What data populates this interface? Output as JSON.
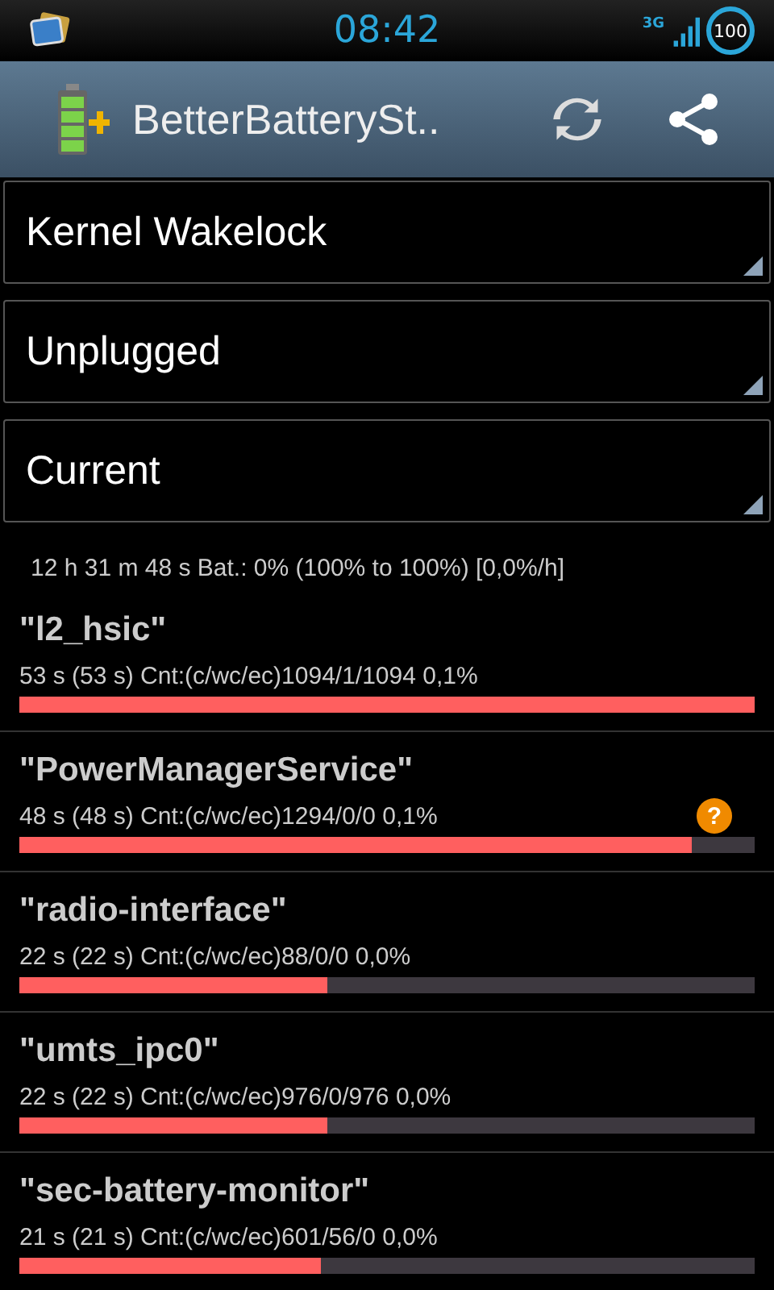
{
  "status_bar": {
    "time": "08:42",
    "network": "3G",
    "battery": "100"
  },
  "action_bar": {
    "title": "BetterBatterySt.."
  },
  "spinners": [
    {
      "value": "Kernel Wakelock"
    },
    {
      "value": "Unplugged"
    },
    {
      "value": "Current"
    }
  ],
  "summary": "12 h 31 m 48 s  Bat.: 0% (100% to 100%) [0,0%/h]",
  "wakelocks": [
    {
      "name": "\"l2_hsic\"",
      "detail": "53 s  (53 s) Cnt:(c/wc/ec)1094/1/1094 0,1%",
      "level": 1.0
    },
    {
      "name": "\"PowerManagerService\"",
      "detail": "48 s  (48 s) Cnt:(c/wc/ec)1294/0/0 0,1%",
      "level": 0.914,
      "badge": "?"
    },
    {
      "name": "\"radio-interface\"",
      "detail": "22 s  (22 s) Cnt:(c/wc/ec)88/0/0 0,0%",
      "level": 0.419
    },
    {
      "name": "\"umts_ipc0\"",
      "detail": "22 s  (22 s) Cnt:(c/wc/ec)976/0/976 0,0%",
      "level": 0.419
    },
    {
      "name": "\"sec-battery-monitor\"",
      "detail": "21 s  (21 s) Cnt:(c/wc/ec)601/56/0 0,0%",
      "level": 0.41
    }
  ]
}
